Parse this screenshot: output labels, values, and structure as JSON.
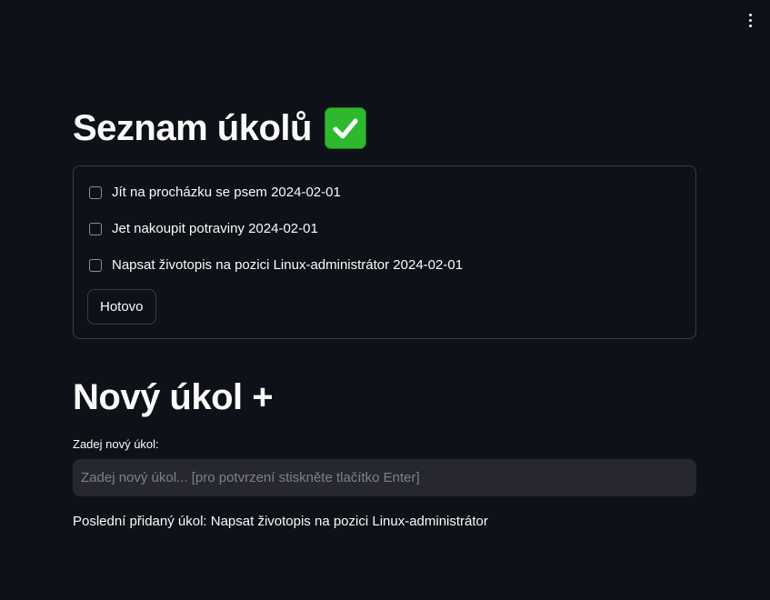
{
  "menu": {
    "icon": "vertical-ellipsis-icon"
  },
  "todo_section": {
    "title": "Seznam úkolů",
    "title_icon": "check-mark-button-icon",
    "tasks": [
      {
        "label": "Jít na procházku se psem 2024-02-01",
        "checked": false
      },
      {
        "label": "Jet nakoupit potraviny 2024-02-01",
        "checked": false
      },
      {
        "label": "Napsat životopis na pozici Linux-administrátor 2024-02-01",
        "checked": false
      }
    ],
    "submit_label": "Hotovo"
  },
  "new_task_section": {
    "title": "Nový úkol +",
    "input_label": "Zadej nový úkol:",
    "input_placeholder": "Zadej nový úkol... [pro potvrzení stiskněte tlačítko Enter]",
    "input_value": "",
    "last_added": "Poslední přidaný úkol: Napsat životopis na pozici Linux-administrátor"
  },
  "colors": {
    "background": "#0e1117",
    "text": "#fafafa",
    "border": "#3a3d46",
    "input_background": "#262730",
    "accent_green": "#2eb82e"
  }
}
